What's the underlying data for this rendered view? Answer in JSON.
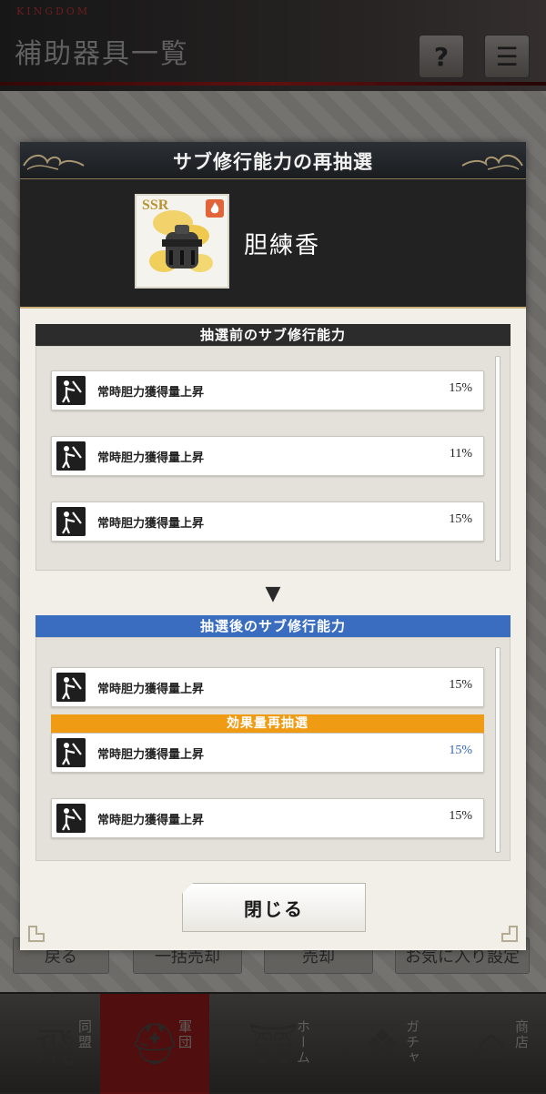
{
  "background": {
    "brand": "KINGDOM",
    "title": "補助器具一覧",
    "help_label": "?",
    "menu_label": "☰",
    "buttons": [
      "戻る",
      "一括売却",
      "売却",
      "お気に入り設定"
    ],
    "nav": [
      {
        "label": "同盟",
        "icon": "flag-icon",
        "glyph": "飛"
      },
      {
        "label": "軍団",
        "icon": "helmet-icon",
        "glyph": "⛑"
      },
      {
        "label": "ホーム",
        "icon": "castle-icon",
        "glyph": "⛩"
      },
      {
        "label": "ガチャ",
        "icon": "crest-icon",
        "glyph": "❖"
      },
      {
        "label": "商店",
        "icon": "shop-icon",
        "glyph": "⌂"
      }
    ]
  },
  "modal": {
    "title": "サブ修行能力の再抽選",
    "item": {
      "name": "胆練香",
      "rarity": "SSR",
      "element_icon": "fire-icon"
    },
    "before": {
      "header": "抽選前のサブ修行能力",
      "rows": [
        {
          "label": "常時胆力獲得量上昇",
          "value": "15%"
        },
        {
          "label": "常時胆力獲得量上昇",
          "value": "11%"
        },
        {
          "label": "常時胆力獲得量上昇",
          "value": "15%"
        }
      ]
    },
    "arrow": "▼",
    "after": {
      "header": "抽選後のサブ修行能力",
      "reroll_tag": "効果量再抽選",
      "rows": [
        {
          "label": "常時胆力獲得量上昇",
          "value": "15%"
        },
        {
          "label": "常時胆力獲得量上昇",
          "value": "15%"
        },
        {
          "label": "常時胆力獲得量上昇",
          "value": "15%"
        }
      ]
    },
    "close_label": "閉じる"
  },
  "colors": {
    "before_header": "#2c2c2c",
    "after_header": "#3a6dc0",
    "reroll_tag": "#f09b14",
    "changed_value": "#2f64b4",
    "item_band": "#222222"
  }
}
